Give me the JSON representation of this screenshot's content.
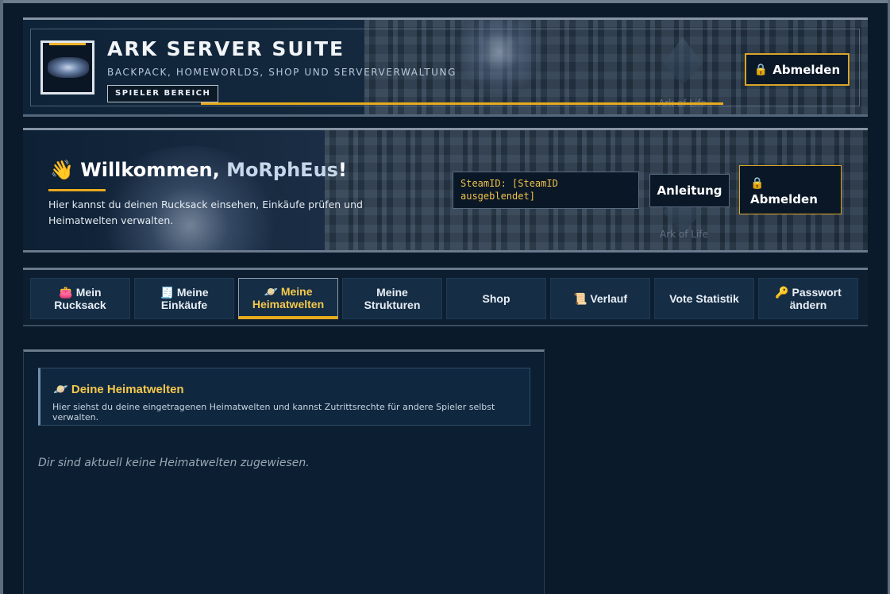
{
  "header": {
    "title": "ARK SERVER SUITE",
    "subtitle": "BACKPACK, HOMEWORLDS, SHOP UND SERVERVERWALTUNG",
    "area_badge": "SPIELER BEREICH",
    "logout_label": "Abmelden",
    "watermark": "Ark of Life"
  },
  "welcome": {
    "emoji": "👋",
    "greeting": "Willkommen, ",
    "username": "MoRphEus",
    "exclaim": "!",
    "text": "Hier kannst du deinen Rucksack einsehen, Einkäufe prüfen und Heimatwelten verwalten.",
    "steamid_line1": "SteamID: [SteamID",
    "steamid_line2": "ausgeblendet]",
    "guide_label": "Anleitung",
    "logout_label": "Abmelden",
    "watermark": "Ark of Life"
  },
  "nav": {
    "tabs": [
      {
        "icon": "👛",
        "line1": "Mein",
        "line2": "Rucksack",
        "active": false
      },
      {
        "icon": "🧾",
        "line1": "Meine",
        "line2": "Einkäufe",
        "active": false
      },
      {
        "icon": "🪐",
        "line1": "Meine",
        "line2": "Heimatwelten",
        "active": true
      },
      {
        "icon": "",
        "line1": "Meine",
        "line2": "Strukturen",
        "active": false
      },
      {
        "icon": "",
        "line1": "Shop",
        "line2": "",
        "active": false
      },
      {
        "icon": "📜",
        "line1": "Verlauf",
        "line2": "",
        "active": false
      },
      {
        "icon": "",
        "line1": "Vote Statistik",
        "line2": "",
        "active": false
      },
      {
        "icon": "🔑",
        "line1": "Passwort",
        "line2": "ändern",
        "active": false
      }
    ]
  },
  "main": {
    "section_icon": "🪐",
    "section_title": "Deine Heimatwelten",
    "section_desc": "Hier siehst du deine eingetragenen Heimatwelten und kannst Zutrittsrechte für andere Spieler selbst verwalten.",
    "empty_note": "Dir sind aktuell keine Heimatwelten zugewiesen."
  },
  "colors": {
    "accent": "#e8aa1f",
    "background": "#0a1a2a",
    "active_tab_text": "#f5c84c"
  }
}
